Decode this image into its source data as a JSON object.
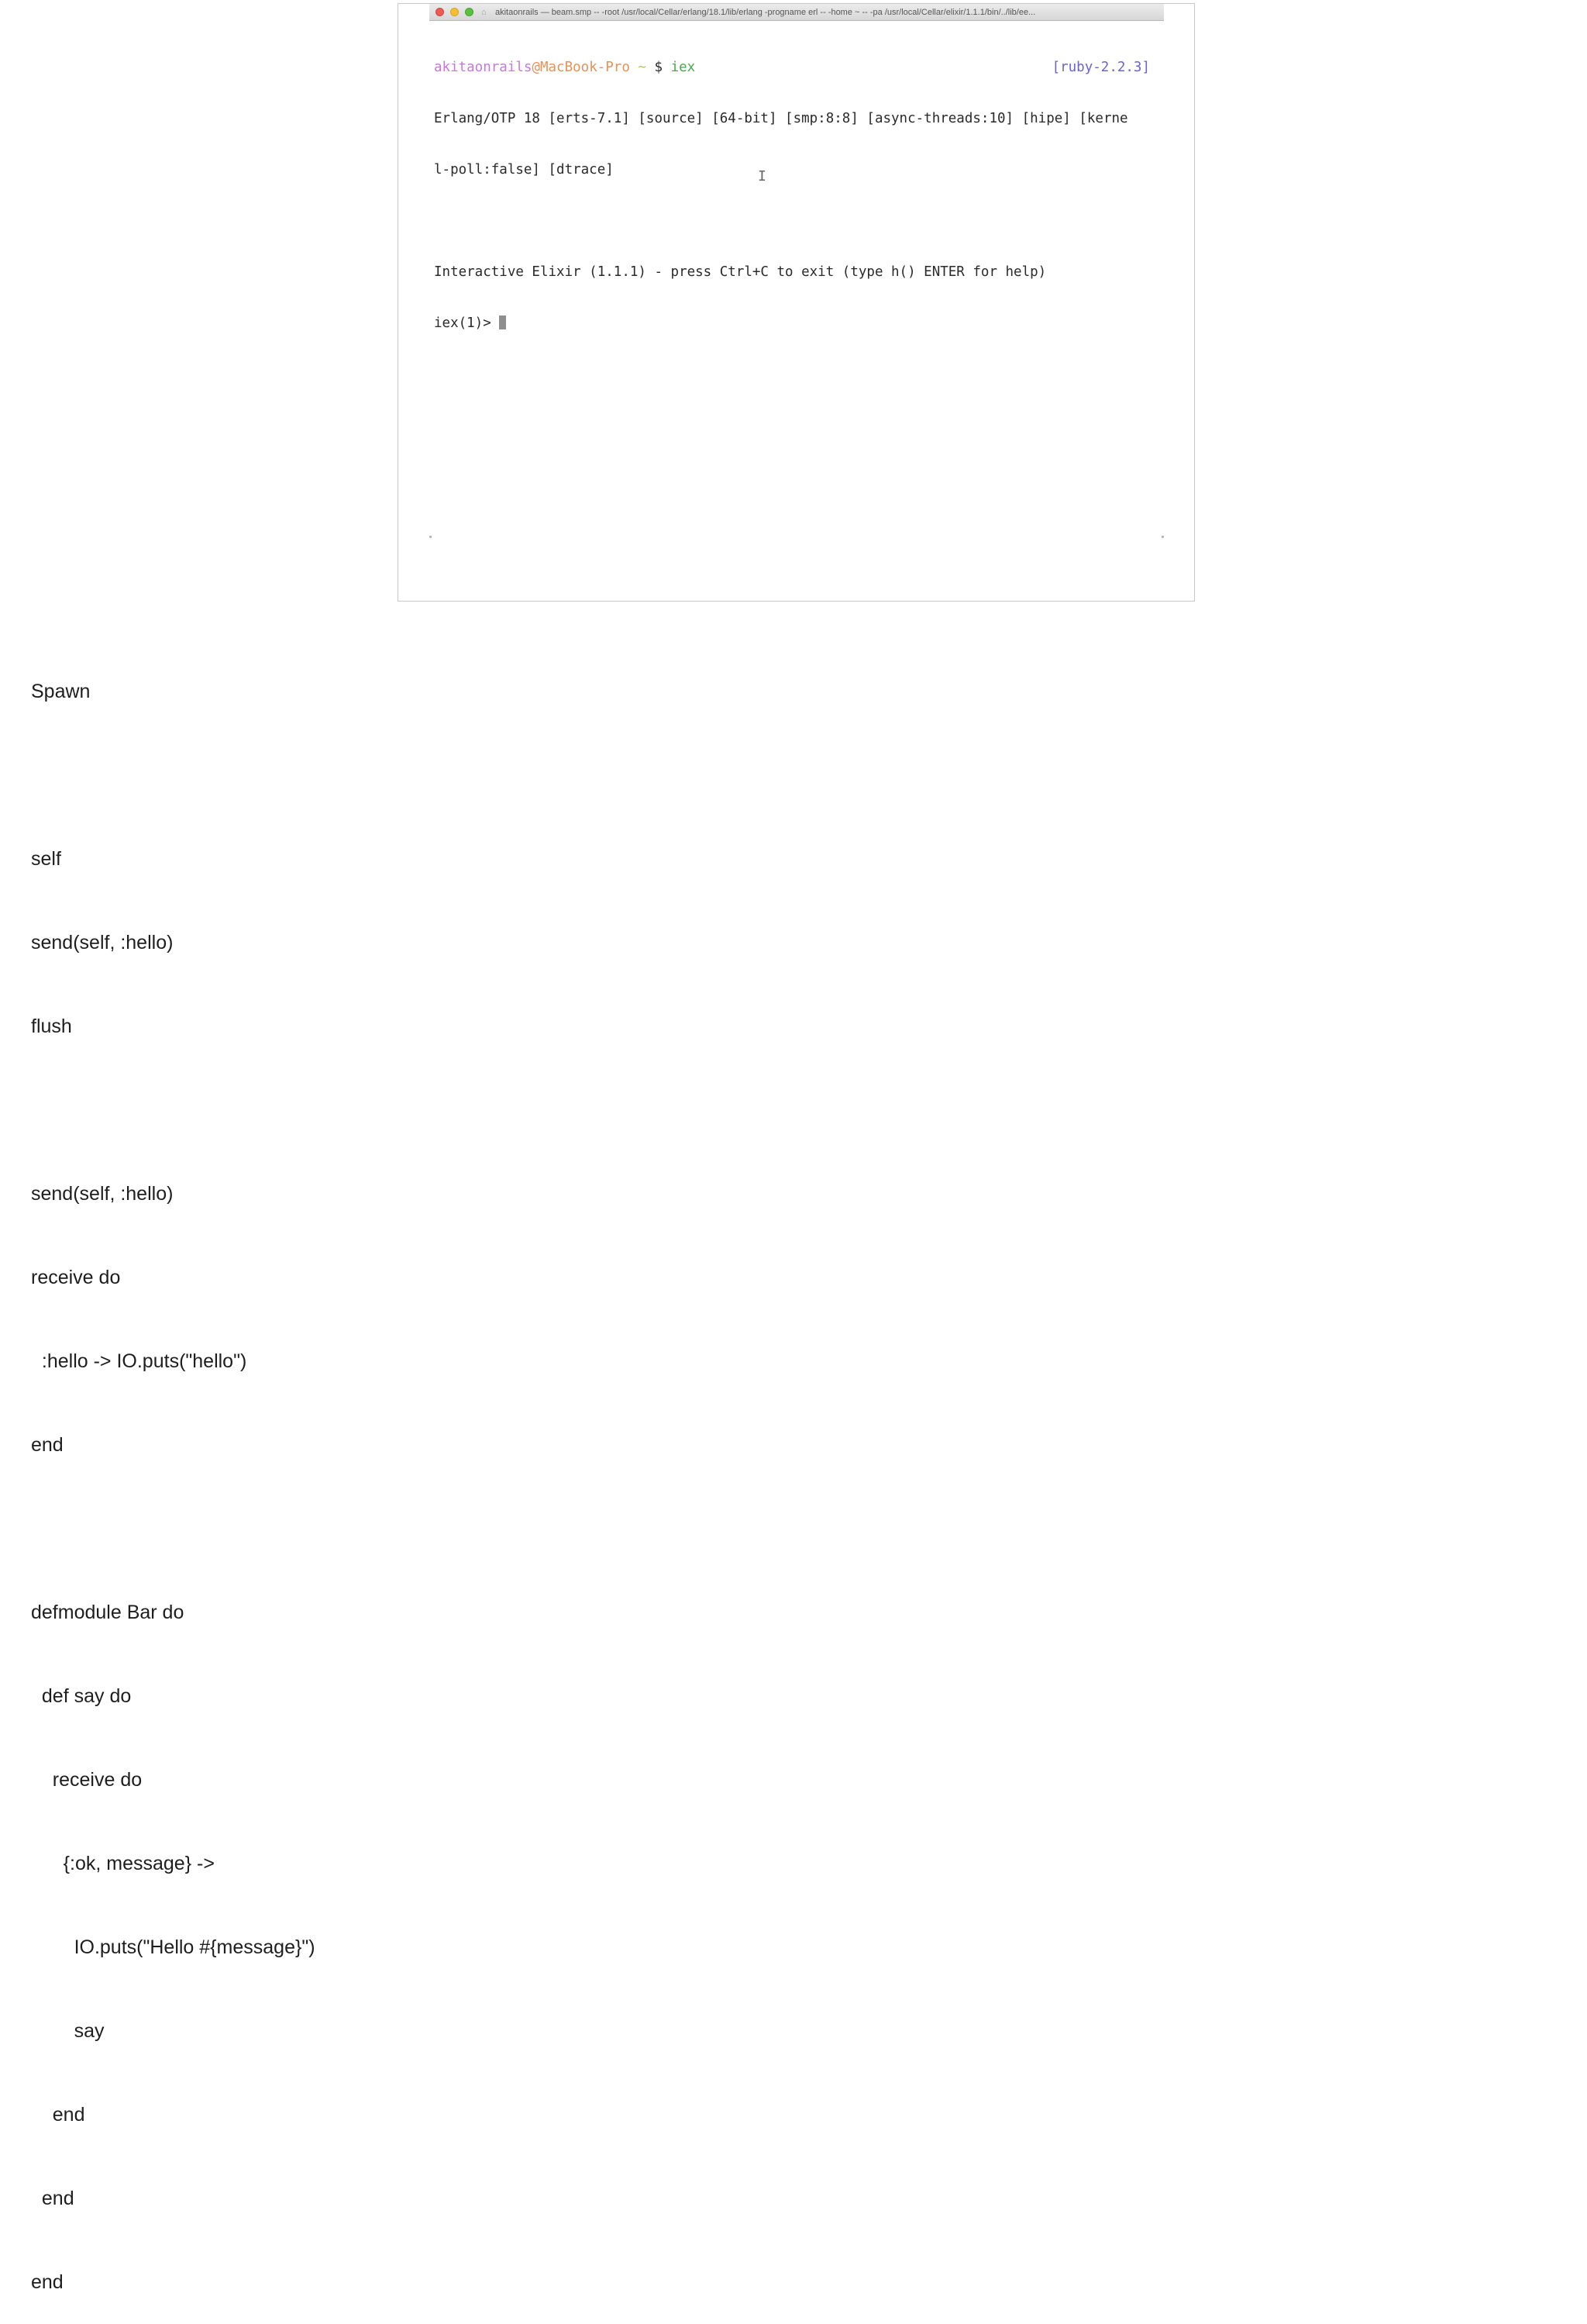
{
  "terminal": {
    "title": "akitaonrails — beam.smp -- -root /usr/local/Cellar/erlang/18.1/lib/erlang -progname erl -- -home ~ -- -pa /usr/local/Cellar/elixir/1.1.1/bin/../lib/ee...",
    "prompt_user": "akitaonrails",
    "prompt_at": "@",
    "prompt_host": "MacBook-Pro",
    "prompt_tilde": " ~ ",
    "prompt_symbol": "$ ",
    "prompt_command": "iex",
    "ruby_version": "[ruby-2.2.3]",
    "lines": [
      "Erlang/OTP 18 [erts-7.1] [source] [64-bit] [smp:8:8] [async-threads:10] [hipe] [kerne",
      "l-poll:false] [dtrace]",
      "",
      "Interactive Elixir (1.1.1) - press Ctrl+C to exit (type h() ENTER for help)"
    ],
    "iex_prompt": "iex(1)> "
  },
  "notes": {
    "lines": [
      "Spawn",
      "",
      "self",
      "send(self, :hello)",
      "flush",
      "",
      "send(self, :hello)",
      "receive do",
      "  :hello -> IO.puts(\"hello\")",
      "end",
      "",
      "defmodule Bar do",
      "  def say do",
      "    receive do",
      "      {:ok, message} ->",
      "        IO.puts(\"Hello #{message}\")",
      "        say",
      "    end",
      "  end",
      "end"
    ]
  }
}
